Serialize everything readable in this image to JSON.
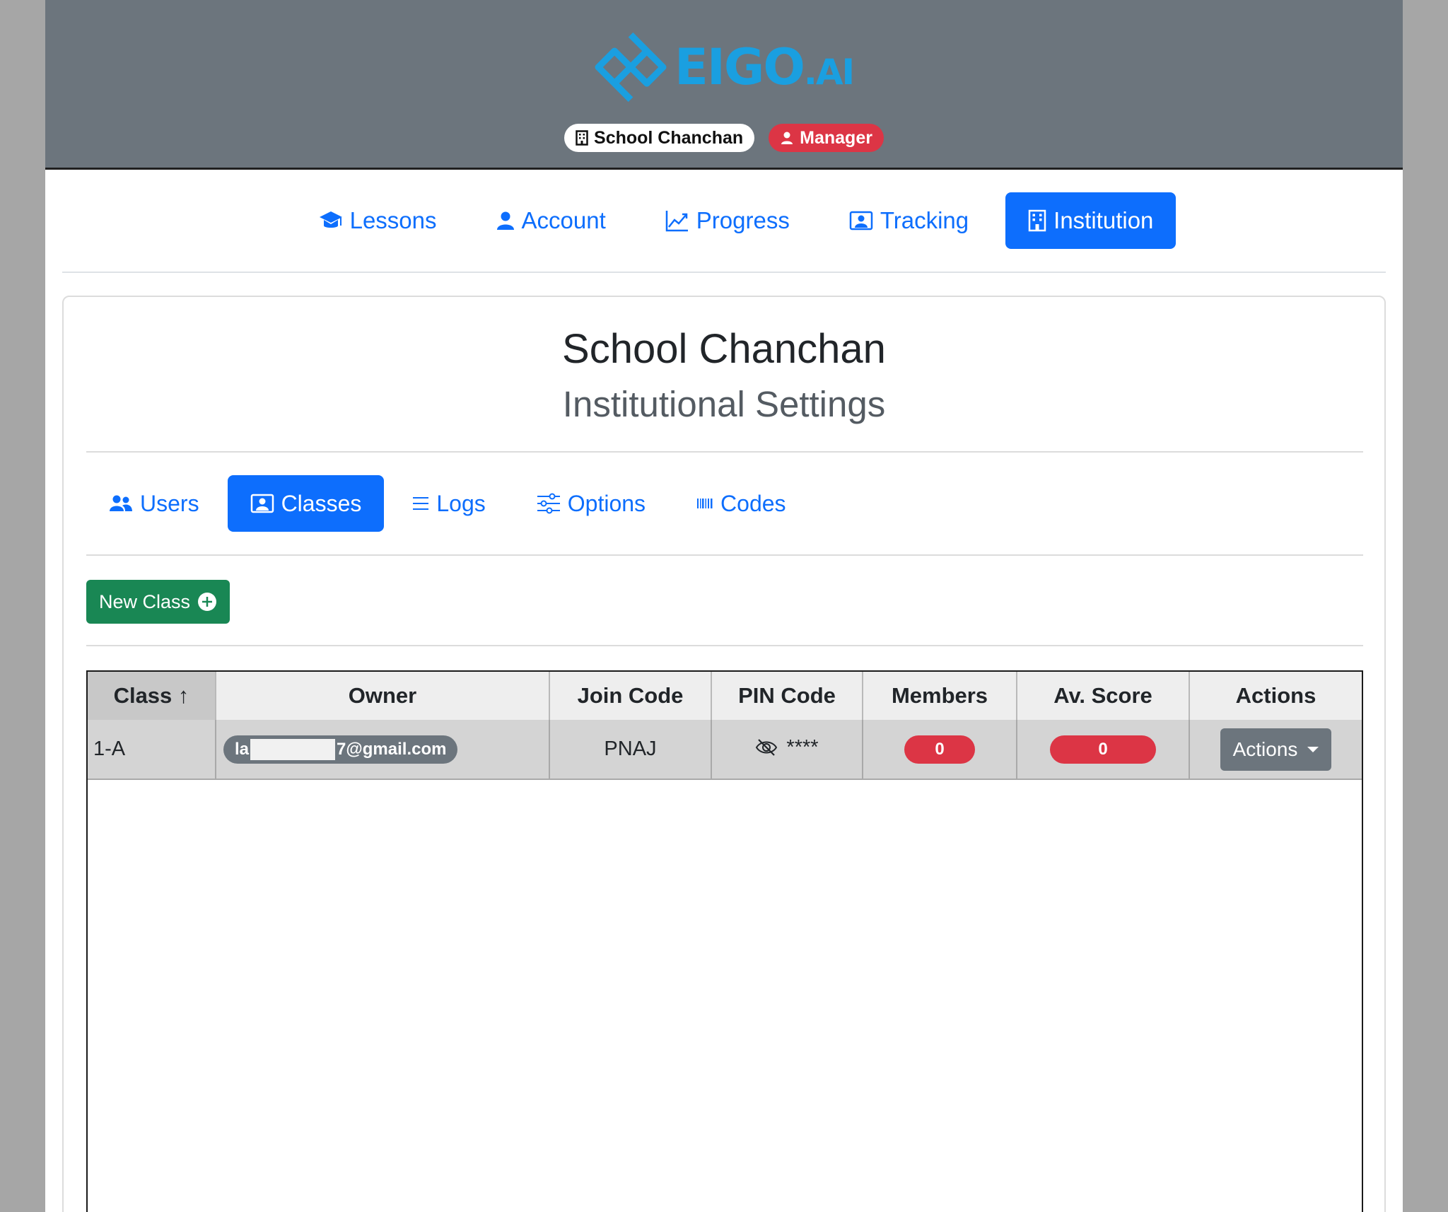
{
  "header": {
    "logo_main": "EIGO",
    "logo_suffix": ".AI",
    "school_badge": "School Chanchan",
    "role_badge": "Manager"
  },
  "nav": {
    "items": [
      {
        "label": "Lessons",
        "icon": "graduation-cap-icon"
      },
      {
        "label": "Account",
        "icon": "person-icon"
      },
      {
        "label": "Progress",
        "icon": "line-chart-icon"
      },
      {
        "label": "Tracking",
        "icon": "person-video-icon"
      },
      {
        "label": "Institution",
        "icon": "building-icon",
        "active": true
      }
    ]
  },
  "card": {
    "title": "School Chanchan",
    "subtitle": "Institutional Settings"
  },
  "subnav": {
    "items": [
      {
        "label": "Users",
        "icon": "people-icon"
      },
      {
        "label": "Classes",
        "icon": "person-video-icon",
        "active": true
      },
      {
        "label": "Logs",
        "icon": "list-icon"
      },
      {
        "label": "Options",
        "icon": "sliders-icon"
      },
      {
        "label": "Codes",
        "icon": "barcode-icon"
      }
    ]
  },
  "new_class_label": "New Class",
  "table": {
    "headers": {
      "class": "Class",
      "sort_arrow": "↑",
      "owner": "Owner",
      "join_code": "Join Code",
      "pin_code": "PIN Code",
      "members": "Members",
      "score": "Av. Score",
      "actions": "Actions"
    },
    "rows": [
      {
        "class": "1-A",
        "owner_prefix": "la",
        "owner_suffix": "7@gmail.com",
        "join_code": "PNAJ",
        "pin_code": "****",
        "members": "0",
        "score": "0",
        "actions_label": "Actions"
      }
    ]
  },
  "colors": {
    "primary": "#0d6efd",
    "success": "#198754",
    "danger": "#dc3545",
    "secondary": "#6c757d",
    "logo": "#1a9fe0"
  }
}
